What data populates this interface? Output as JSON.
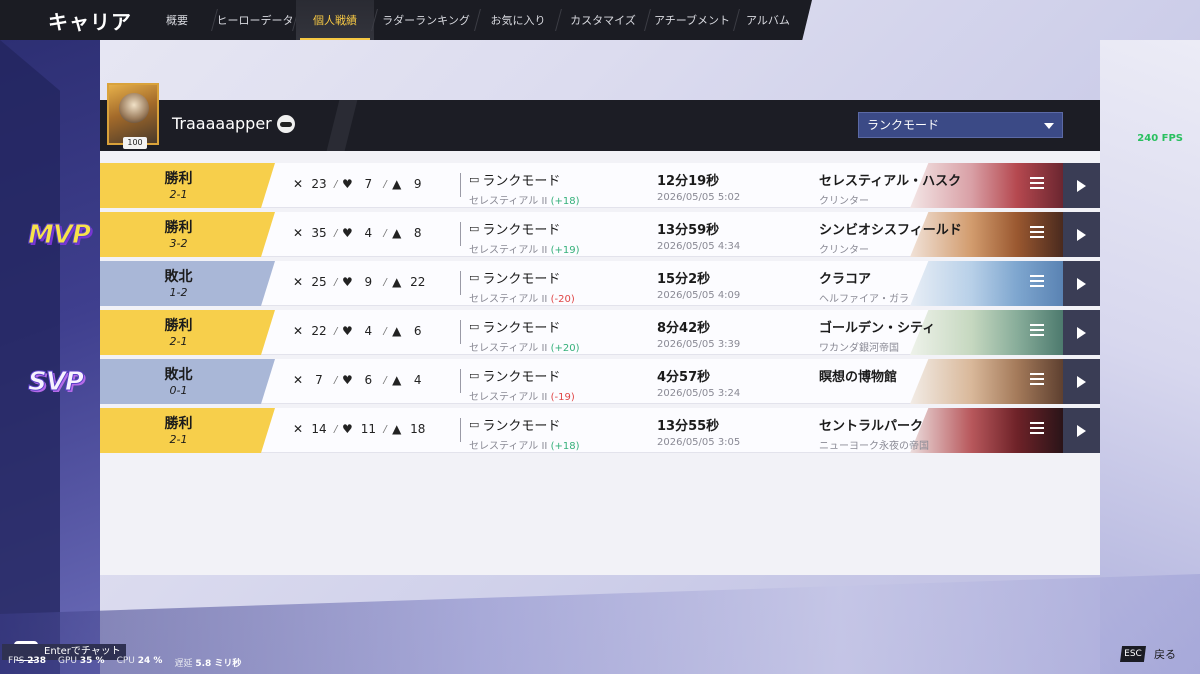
{
  "app": {
    "title": "キャリア"
  },
  "tabs": [
    {
      "label": "概要",
      "active": false
    },
    {
      "label": "ヒーローデータ",
      "active": false
    },
    {
      "label": "個人戦績",
      "active": true
    },
    {
      "label": "ラダーランキング",
      "active": false
    },
    {
      "label": "お気に入り",
      "active": false
    },
    {
      "label": "カスタマイズ",
      "active": false
    },
    {
      "label": "アチーブメント",
      "active": false
    },
    {
      "label": "アルバム",
      "active": false
    }
  ],
  "player": {
    "name": "Traaaaapper",
    "level": "100"
  },
  "mode_dropdown": {
    "selected": "ランクモード"
  },
  "fps_overlay": "240 FPS",
  "awards": {
    "mvp": "MVP",
    "svp": "SVP"
  },
  "accent_colors": {
    "win": "#f7cf4b",
    "loss": "#a9b7d7",
    "rank_up": "#35b07a",
    "rank_down": "#e04747"
  },
  "matches": [
    {
      "result": "勝利",
      "score": "2-1",
      "kills": "23",
      "deaths": "7",
      "assists": "9",
      "mode": "ランクモード",
      "rank": "セレスティアル II",
      "delta": "(+18)",
      "duration": "12分19秒",
      "date": "2026/05/05 5:02",
      "map": "セレスティアル・ハスク",
      "submap": "クリンター"
    },
    {
      "result": "勝利",
      "score": "3-2",
      "kills": "35",
      "deaths": "4",
      "assists": "8",
      "mode": "ランクモード",
      "rank": "セレスティアル II",
      "delta": "(+19)",
      "duration": "13分59秒",
      "date": "2026/05/05 4:34",
      "map": "シンビオシスフィールド",
      "submap": "クリンター"
    },
    {
      "result": "敗北",
      "score": "1-2",
      "kills": "25",
      "deaths": "9",
      "assists": "22",
      "mode": "ランクモード",
      "rank": "セレスティアル II",
      "delta": "(-20)",
      "duration": "15分2秒",
      "date": "2026/05/05 4:09",
      "map": "クラコア",
      "submap": "ヘルファイア・ガラ"
    },
    {
      "result": "勝利",
      "score": "2-1",
      "kills": "22",
      "deaths": "4",
      "assists": "6",
      "mode": "ランクモード",
      "rank": "セレスティアル II",
      "delta": "(+20)",
      "duration": "8分42秒",
      "date": "2026/05/05 3:39",
      "map": "ゴールデン・シティ",
      "submap": "ワカンダ銀河帝国"
    },
    {
      "result": "敗北",
      "score": "0-1",
      "kills": "7",
      "deaths": "6",
      "assists": "4",
      "mode": "ランクモード",
      "rank": "セレスティアル II",
      "delta": "(-19)",
      "duration": "4分57秒",
      "date": "2026/05/05 3:24",
      "map": "瞑想の博物館",
      "submap": ""
    },
    {
      "result": "勝利",
      "score": "2-1",
      "kills": "14",
      "deaths": "11",
      "assists": "18",
      "mode": "ランクモード",
      "rank": "セレスティアル II",
      "delta": "(+18)",
      "duration": "13分55秒",
      "date": "2026/05/05 3:05",
      "map": "セントラルパーク",
      "submap": "ニューヨーク永夜の帝国"
    }
  ],
  "footer": {
    "chat_hint": "Enterでチャット",
    "fps_label": "FPS",
    "fps_value": "238",
    "gpu_label": "GPU",
    "gpu_value": "35 %",
    "cpu_label": "CPU",
    "cpu_value": "24 %",
    "latency_label": "遅延",
    "latency_value": "5.8 ミリ秒",
    "esc_key": "ESC",
    "esc_label": "戻る"
  }
}
